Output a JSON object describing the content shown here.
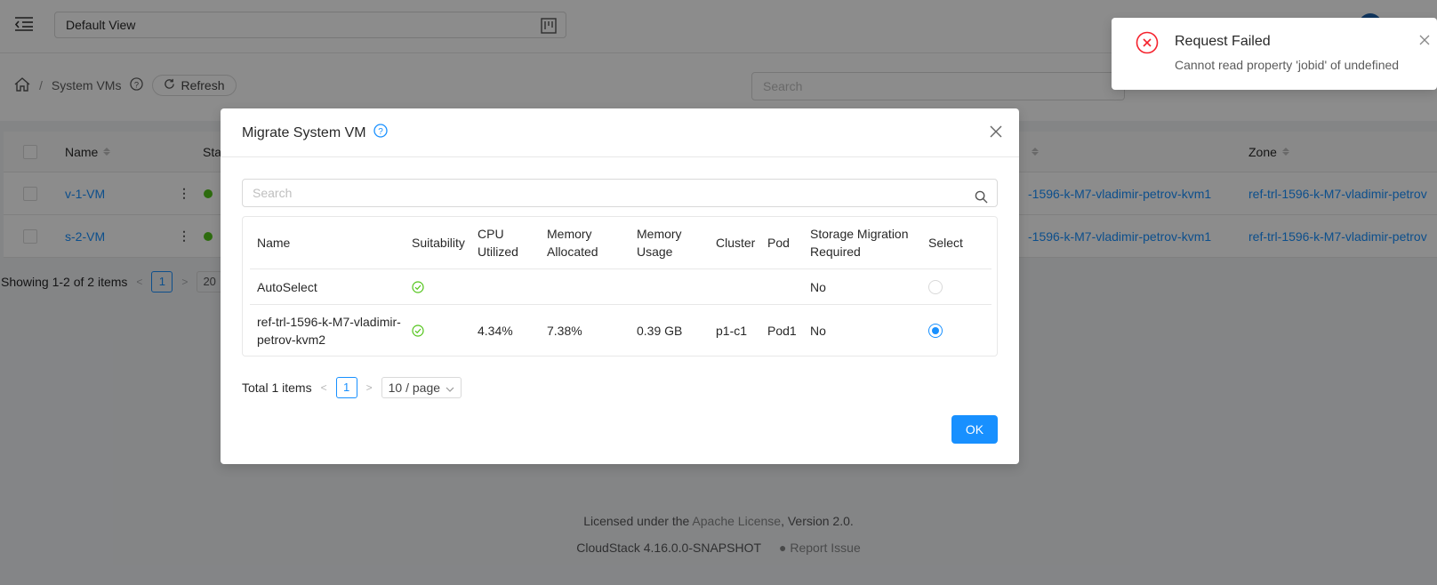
{
  "topbar": {
    "view_select": "Default View"
  },
  "breadcrumb": {
    "current": "System VMs",
    "refresh_label": "Refresh"
  },
  "page": {
    "search_placeholder": "Search"
  },
  "vm_table": {
    "columns": [
      "Name",
      "Sta",
      "Zone"
    ],
    "rows": [
      {
        "name": "v-1-VM",
        "host": "-1596-k-M7-vladimir-petrov-kvm1",
        "zone": "ref-trl-1596-k-M7-vladimir-petrov"
      },
      {
        "name": "s-2-VM",
        "host": "-1596-k-M7-vladimir-petrov-kvm1",
        "zone": "ref-trl-1596-k-M7-vladimir-petrov"
      }
    ],
    "pagination": {
      "summary": "Showing 1-2 of 2 items",
      "page": "1",
      "size": "20"
    }
  },
  "modal": {
    "title": "Migrate System VM",
    "search_placeholder": "Search",
    "columns": {
      "name": "Name",
      "suitability": "Suitability",
      "cpu_line1": "CPU",
      "cpu_line2": "Utilized",
      "mem_alloc_line1": "Memory",
      "mem_alloc_line2": "Allocated",
      "mem_usage_line1": "Memory",
      "mem_usage_line2": "Usage",
      "cluster": "Cluster",
      "pod": "Pod",
      "storage_line1": "Storage Migration",
      "storage_line2": "Required",
      "select": "Select"
    },
    "rows": [
      {
        "name": "AutoSelect",
        "suitable": true,
        "cpu": "",
        "mem_alloc": "",
        "mem_usage": "",
        "cluster": "",
        "pod": "",
        "storage": "No",
        "selected": false
      },
      {
        "name_line1": "ref-trl-1596-k-M7-vladimir-",
        "name_line2": "petrov-kvm2",
        "suitable": true,
        "cpu": "4.34%",
        "mem_alloc": "7.38%",
        "mem_usage": "0.39 GB",
        "cluster": "p1-c1",
        "pod": "Pod1",
        "storage": "No",
        "selected": true
      }
    ],
    "pagination": {
      "total": "Total 1 items",
      "page": "1",
      "page_size": "10 / page"
    },
    "ok_label": "OK"
  },
  "notification": {
    "title": "Request Failed",
    "description": "Cannot read property 'jobid' of undefined"
  },
  "footer": {
    "license_prefix": "Licensed under the ",
    "license_link": "Apache License",
    "license_suffix": ", Version 2.0.",
    "version": "CloudStack 4.16.0.0-SNAPSHOT",
    "report_issue": "Report Issue"
  },
  "colors": {
    "primary": "#1890ff",
    "success": "#52c41a",
    "error": "#f5222d"
  }
}
